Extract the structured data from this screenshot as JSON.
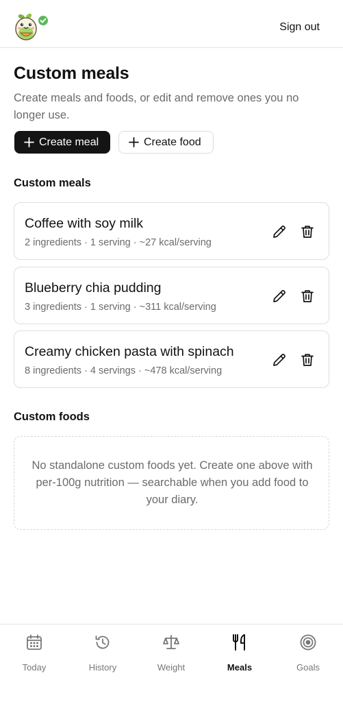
{
  "header": {
    "sign_out_label": "Sign out"
  },
  "page": {
    "title": "Custom meals",
    "description": "Create meals and foods, or edit and remove ones you no longer use."
  },
  "actions": {
    "create_meal_label": "Create meal",
    "create_food_label": "Create food"
  },
  "meals_section": {
    "title": "Custom meals",
    "items": [
      {
        "name": "Coffee with soy milk",
        "meta": "2 ingredients · 1 serving · ~27 kcal/serving"
      },
      {
        "name": "Blueberry chia pudding",
        "meta": "3 ingredients · 1 serving · ~311 kcal/serving"
      },
      {
        "name": "Creamy chicken pasta with spinach",
        "meta": "8 ingredients · 4 servings · ~478 kcal/serving"
      }
    ]
  },
  "foods_section": {
    "title": "Custom foods",
    "empty_message": "No standalone custom foods yet. Create one above with per-100g nutrition — searchable when you add food to your diary."
  },
  "nav": {
    "items": [
      {
        "label": "Today",
        "icon": "calendar-icon"
      },
      {
        "label": "History",
        "icon": "history-icon"
      },
      {
        "label": "Weight",
        "icon": "scale-icon"
      },
      {
        "label": "Meals",
        "icon": "fork-knife-icon",
        "active": true
      },
      {
        "label": "Goals",
        "icon": "target-icon"
      }
    ]
  },
  "colors": {
    "primary_button": "#141414",
    "text": "#111111",
    "muted_text": "#6b6b6b",
    "logo_green": "#8cc63f",
    "check_badge": "#5cb85c"
  }
}
